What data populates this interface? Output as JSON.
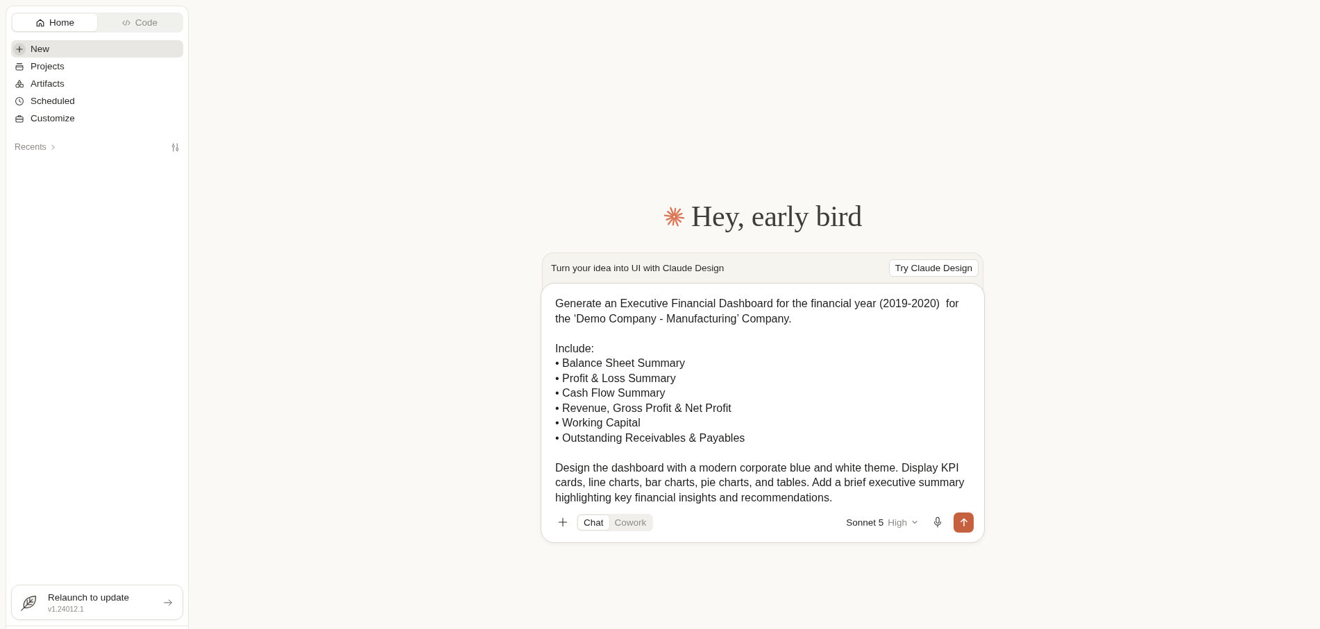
{
  "sidebar": {
    "tabs": [
      {
        "label": "Home",
        "selected": true
      },
      {
        "label": "Code",
        "selected": false
      }
    ],
    "nav_items": [
      {
        "label": "New",
        "selected": true
      },
      {
        "label": "Projects",
        "selected": false
      },
      {
        "label": "Artifacts",
        "selected": false
      },
      {
        "label": "Scheduled",
        "selected": false
      },
      {
        "label": "Customize",
        "selected": false
      }
    ],
    "recents": {
      "label": "Recents"
    },
    "update_card": {
      "title": "Relaunch to update",
      "version": "v1.24012.1"
    }
  },
  "main": {
    "greeting": "Hey, early bird",
    "banner": {
      "text": "Turn your idea into UI with Claude Design",
      "button": "Try Claude Design"
    },
    "composer": {
      "value": "Generate an Executive Financial Dashboard for the financial year (2019-2020)  for the ‘Demo Company - Manufacturing’ Company.\n\nInclude:\n• Balance Sheet Summary\n• Profit & Loss Summary\n• Cash Flow Summary\n• Revenue, Gross Profit & Net Profit\n• Working Capital\n• Outstanding Receivables & Payables\n\nDesign the dashboard with a modern corporate blue and white theme. Display KPI cards, line charts, bar charts, pie charts, and tables. Add a brief executive summary highlighting key financial insights and recommendations.",
      "modes": [
        {
          "label": "Chat",
          "selected": true
        },
        {
          "label": "Cowork",
          "selected": false
        }
      ],
      "model": "Sonnet 5",
      "effort": "High"
    }
  }
}
